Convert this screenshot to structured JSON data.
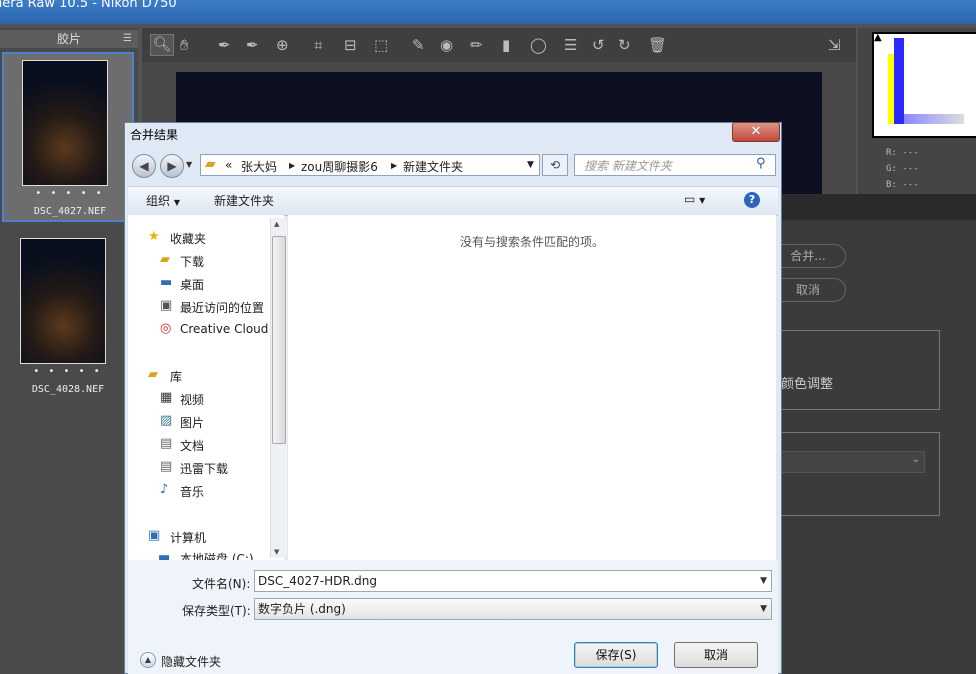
{
  "app": {
    "title": "nera Raw 10.5 -  Nikon D750"
  },
  "filmstrip": {
    "header": "胶片",
    "menu_icon": "menu-lines-icon",
    "items": [
      {
        "name": "DSC_4027.NEF",
        "rating": "• • • • •",
        "selected": true
      },
      {
        "name": "DSC_4028.NEF",
        "rating": "• • • • •",
        "selected": false
      }
    ]
  },
  "toolbar": {
    "icons": [
      "zoom-icon",
      "hand-icon",
      "white-balance-icon",
      "color-sampler-icon",
      "target-adjust-icon",
      "crop-icon",
      "straighten-icon",
      "transform-icon",
      "spot-removal-icon",
      "red-eye-icon",
      "adjustment-brush-icon",
      "graduated-filter-icon",
      "radial-filter-icon",
      "list-icon",
      "rotate-left-icon",
      "rotate-right-icon",
      "trash-icon",
      "fullscreen-icon"
    ]
  },
  "histogram": {
    "r_label": "R:",
    "g_label": "G:",
    "b_label": "B:",
    "r_value": "---",
    "g_value": "---",
    "b_value": "---"
  },
  "hdr_panel": {
    "merge_button": "合并...",
    "cancel_button": "取消",
    "color_adjust_label": "颜色调整"
  },
  "dialog": {
    "title": "合并结果",
    "close_label": "✕",
    "address": {
      "prefix": "«",
      "crumbs": [
        "张大妈",
        "zou周聊摄影6",
        "新建文件夹"
      ]
    },
    "search_placeholder": "搜索 新建文件夹",
    "commands": {
      "organize": "组织",
      "new_folder": "新建文件夹",
      "help": "?"
    },
    "nav": {
      "favorites_header": "收藏夹",
      "favorites": [
        "下载",
        "桌面",
        "最近访问的位置",
        "Creative Cloud"
      ],
      "libraries_header": "库",
      "libraries": [
        "视频",
        "图片",
        "文档",
        "迅雷下载",
        "音乐"
      ],
      "computer_header": "计算机",
      "computer_items": [
        "本地磁盘 (C:)"
      ]
    },
    "empty_message": "没有与搜索条件匹配的项。",
    "filename_label": "文件名(N):",
    "filename_value": "DSC_4027-HDR.dng",
    "filetype_label": "保存类型(T):",
    "filetype_value": "数字负片 (.dng)",
    "hide_folders": "隐藏文件夹",
    "save_button": "保存(S)",
    "cancel_button": "取消"
  }
}
